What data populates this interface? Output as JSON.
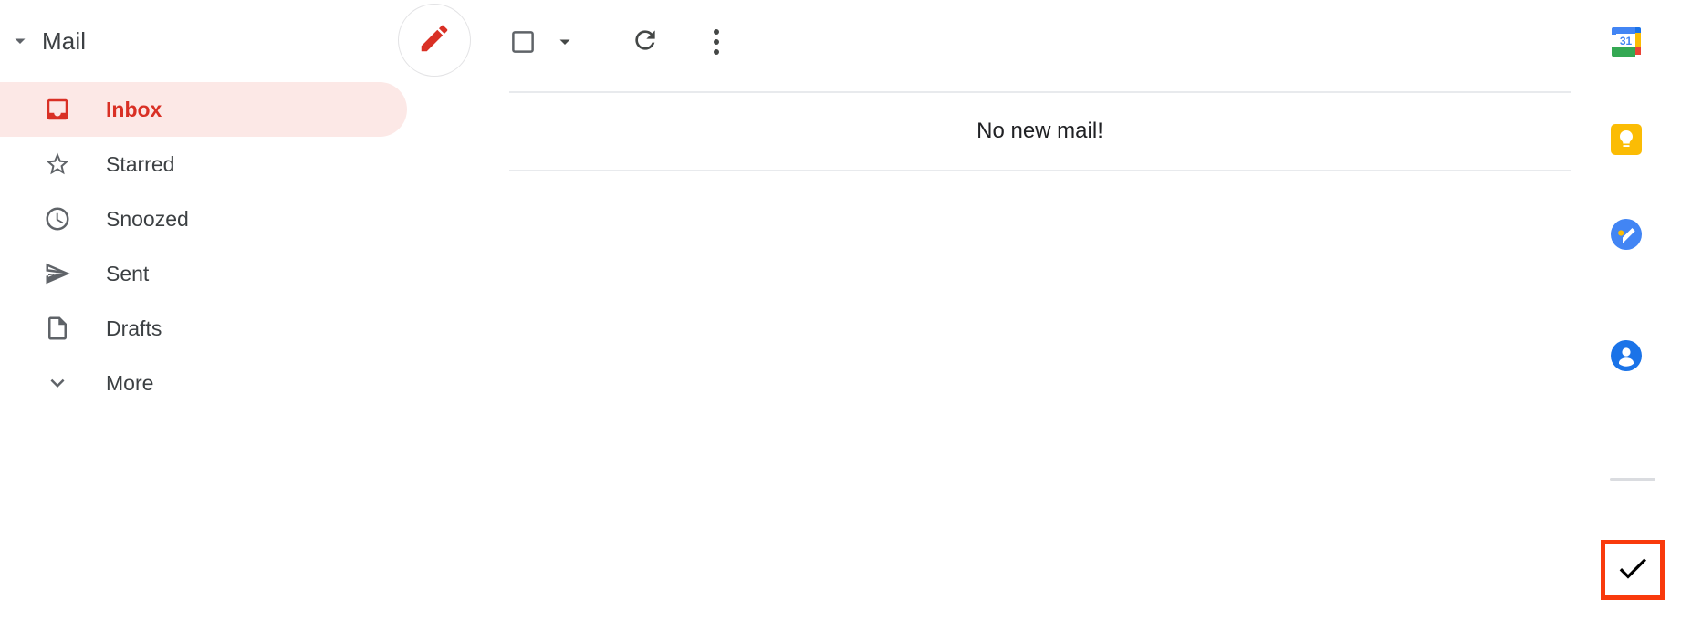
{
  "sidebar": {
    "header": {
      "caret_icon": "caret-down-icon",
      "title": "Mail",
      "compose_icon": "pencil-compose-icon",
      "compose_label": "Compose"
    },
    "items": [
      {
        "label": "Inbox",
        "icon": "inbox-icon",
        "active": true
      },
      {
        "label": "Starred",
        "icon": "star-outline-icon",
        "active": false
      },
      {
        "label": "Snoozed",
        "icon": "clock-icon",
        "active": false
      },
      {
        "label": "Sent",
        "icon": "send-icon",
        "active": false
      },
      {
        "label": "Drafts",
        "icon": "document-icon",
        "active": false
      },
      {
        "label": "More",
        "icon": "chevron-down-icon",
        "active": false
      }
    ]
  },
  "toolbar": {
    "select_all_icon": "checkbox-unchecked-icon",
    "select_all_caret_icon": "caret-down-icon",
    "refresh_icon": "refresh-icon",
    "more_options_icon": "more-vertical-icon"
  },
  "main": {
    "empty_message": "No new mail!"
  },
  "rail": {
    "items": [
      {
        "name": "calendar",
        "icon": "google-calendar-icon",
        "day": "31"
      },
      {
        "name": "keep",
        "icon": "google-keep-icon"
      },
      {
        "name": "tasks",
        "icon": "google-tasks-icon"
      },
      {
        "name": "contacts",
        "icon": "google-contacts-icon"
      }
    ],
    "highlighted": {
      "name": "checkmark",
      "icon": "checkmark-icon",
      "border_color": "#f93a0c"
    }
  },
  "colors": {
    "accent_red": "#d93025",
    "active_pill_bg": "#fce8e6",
    "divider": "#e8eaed",
    "text_primary": "#3c4043",
    "highlight_border": "#f93a0c"
  }
}
